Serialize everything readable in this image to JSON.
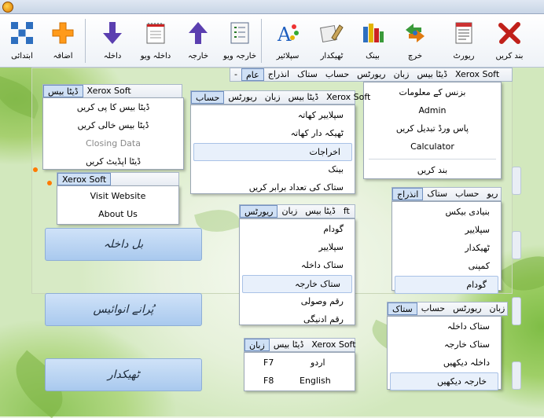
{
  "toolbar": {
    "items": [
      {
        "label": "بند کریں",
        "icon": "close-x-icon"
      },
      {
        "label": "ریورٹ",
        "icon": "report-icon"
      },
      {
        "label": "خرچ",
        "icon": "expense-arrows-icon"
      },
      {
        "label": "بینک",
        "icon": "bank-books-icon"
      },
      {
        "label": "ٹھیکدار",
        "icon": "contractor-icon"
      },
      {
        "label": "سپلائیر",
        "icon": "supplier-text-icon"
      },
      {
        "label": "خارجہ ویو",
        "icon": "outgoing-view-icon"
      },
      {
        "label": "خارجہ",
        "icon": "up-arrow-icon"
      },
      {
        "label": "داخلہ ویو",
        "icon": "incoming-view-icon"
      },
      {
        "label": "داخلہ",
        "icon": "down-arrow-icon"
      },
      {
        "label": "اضافہ",
        "icon": "plus-icon"
      },
      {
        "label": "ابتدائی",
        "icon": "grid-icon"
      }
    ]
  },
  "main_menu": {
    "items": [
      "-",
      "عام",
      "انذراج",
      "ستاک",
      "حساب",
      "ریورٹس",
      "زبان",
      "ڈیٹا بیس",
      "Xerox Soft"
    ],
    "dropdown": [
      "بزنس کے معلومات",
      "Admin",
      "پاس ورڈ تبدیل کریں",
      "Calculator",
      "بند کریں"
    ]
  },
  "database_menu": {
    "items": [
      "ڈیٹا بیس",
      "Xerox Soft"
    ],
    "dropdown": [
      "ڈیٹا بیس کا پی کریں",
      "ڈیٹا بیس خالی کریں",
      "Closing Data",
      "ڈیٹا اپڈیٹ کریں"
    ]
  },
  "xerox_menu": {
    "items": [
      "Xerox Soft"
    ],
    "dropdown": [
      "Visit Website",
      "About Us"
    ]
  },
  "account_menu": {
    "items": [
      "حساب",
      "ریورٹس",
      "زبان",
      "ڈیٹا بیس",
      "Xerox Soft"
    ],
    "dropdown": [
      "سپلاییر کھاتہ",
      "ٹھیکہ دار کھاتہ",
      "اخراجات",
      "بینک",
      "ستاک کی تعداد برابر کریں"
    ]
  },
  "entry_menu": {
    "items": [
      "انذراج",
      "ستاک",
      "حساب",
      "ریو"
    ],
    "dropdown": [
      "بنیادی بیکس",
      "سپلاییر",
      "ٹھیکدار",
      "کمپنی",
      "گودام"
    ]
  },
  "reports_menu": {
    "items": [
      "ریورٹس",
      "زبان",
      "ڈیٹا بیس",
      "ft"
    ],
    "dropdown": [
      "گودام",
      "سپلاییر",
      "ستاک داخلہ",
      "ستاک خارجہ",
      "رقم وصولی",
      "رقم ادنیگی"
    ]
  },
  "stock_menu": {
    "items": [
      "ستاک",
      "حساب",
      "ریورٹس",
      "زبان"
    ],
    "dropdown": [
      "ستاک داخلہ",
      "ستاک خارجہ",
      "داخلہ دیکھیں",
      "خارجہ دیکھیں"
    ]
  },
  "language_menu": {
    "items": [
      "زبان",
      "ڈیٹا بیس",
      "Xerox Soft"
    ],
    "dropdown": [
      {
        "label": "اردو",
        "shortcut": "F7"
      },
      {
        "label": "English",
        "shortcut": "F8"
      }
    ]
  },
  "big_buttons": [
    "بل داخلہ",
    "پُرانے انوائیس",
    "ٹھیکدار"
  ]
}
